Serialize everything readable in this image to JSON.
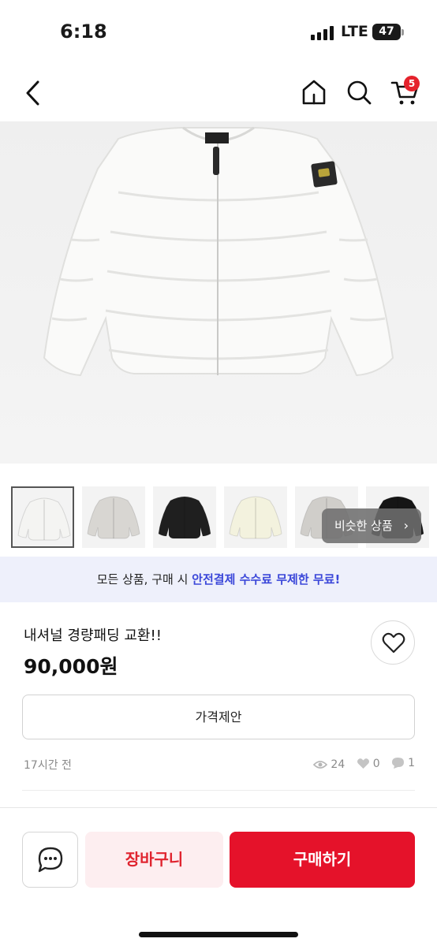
{
  "status_bar": {
    "time": "6:18",
    "network": "LTE",
    "battery": "47"
  },
  "header": {
    "cart_count": "5"
  },
  "icons": [
    "back-icon",
    "home-icon",
    "search-icon",
    "cart-icon",
    "heart-icon",
    "eye-icon",
    "chat-icon",
    "chevron-right-icon"
  ],
  "gallery": {
    "thumbnail_colors": [
      "#f4f4f2",
      "#d8d6d2",
      "#1f1f1f",
      "#f3f2de",
      "#d0ceca",
      "#151515"
    ],
    "selected_index": 0,
    "similar_label": "비슷한 상품"
  },
  "banner": {
    "text_before": "모든 상품, 구매 시 ",
    "text_accent": "안전결제 수수료 무제한 무료!"
  },
  "product": {
    "title": "내셔널 경량패딩 교환!!",
    "price": "90,000원",
    "offer_label": "가격제안",
    "posted": "17시간 전",
    "views": "24",
    "likes": "0",
    "chats": "1"
  },
  "actions": {
    "cart_label": "장바구니",
    "buy_label": "구매하기"
  },
  "colors": {
    "accent_red": "#e5122a",
    "badge_red": "#e5222c",
    "banner_blue": "#3b47d9"
  }
}
